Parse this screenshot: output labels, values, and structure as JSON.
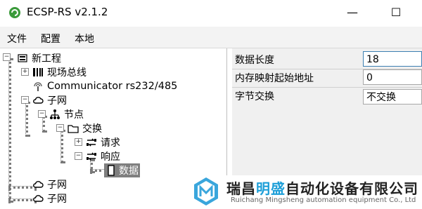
{
  "window": {
    "title": "ECSP-RS v2.1.2",
    "minimize": "—",
    "maximize": "☐"
  },
  "menu": [
    "文件",
    "配置",
    "本地"
  ],
  "tree": {
    "root": "新工程",
    "fieldbus": "现场总线",
    "communicator": "Communicator rs232/485",
    "subnet1": "子网",
    "node": "节点",
    "exchange": "交换",
    "request": "请求",
    "response": "响应",
    "data": "数据",
    "subnet2": "子网",
    "subnet3": "子网"
  },
  "properties": [
    {
      "label": "数据长度",
      "value": "18"
    },
    {
      "label": "内存映射起始地址",
      "value": "0"
    },
    {
      "label": "字节交换",
      "value": "不交换"
    }
  ],
  "watermark": {
    "brand_prefix": "瑞昌",
    "brand_highlight": "明盛",
    "brand_suffix": "自动化设备有限公司",
    "brand_en": "Ruichang Mingsheng automation equipment Co., Ltd"
  },
  "colors": {
    "selected": "#7f7f7f",
    "accent": "#1e9fd8"
  }
}
